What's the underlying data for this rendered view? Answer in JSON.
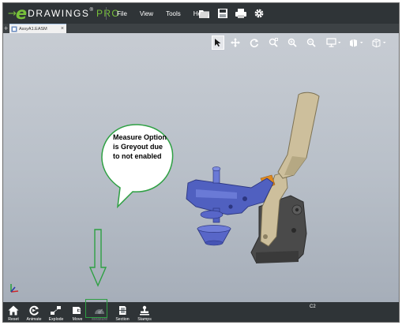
{
  "app": {
    "logo_word": "DRAWINGS",
    "logo_mark": "e",
    "logo_trademark": "®",
    "logo_edition": "PRO"
  },
  "menu": [
    "File",
    "View",
    "Tools",
    "Help"
  ],
  "quick_access": [
    "open-icon",
    "save-icon",
    "print-icon",
    "gear-icon"
  ],
  "tab": {
    "label": "AssyA1.EASM",
    "close": "×",
    "new": "+"
  },
  "view_toolbar": [
    "select-icon",
    "pan-icon",
    "rotate-icon",
    "zoom-fit-icon",
    "zoom-area-icon",
    "zoom-icon",
    "display-style-icon",
    "view-orientation-icon",
    "3d-view-icon"
  ],
  "annotation": {
    "text": "Measure Option is Greyout due to not enabled"
  },
  "bottom_toolbar": [
    {
      "label": "Reset",
      "icon": "home-icon",
      "enabled": true
    },
    {
      "label": "Animate",
      "icon": "animate-icon",
      "enabled": true
    },
    {
      "label": "Explode",
      "icon": "explode-icon",
      "enabled": true
    },
    {
      "label": "Move",
      "icon": "move-icon",
      "enabled": true
    },
    {
      "label": "Measure",
      "icon": "measure-icon",
      "enabled": false
    },
    {
      "label": "Section",
      "icon": "section-icon",
      "enabled": true
    },
    {
      "label": "Stamps",
      "icon": "stamp-icon",
      "enabled": true
    }
  ],
  "configuration": "C2",
  "colors": {
    "brand_green": "#78c13a",
    "callout_green": "#2ea043",
    "chrome": "#2f3437",
    "clamp_blue": "#5060c0",
    "handle_tan": "#cdbf9c",
    "body_grey": "#4a4a4a",
    "accent_orange": "#e08a1e"
  }
}
